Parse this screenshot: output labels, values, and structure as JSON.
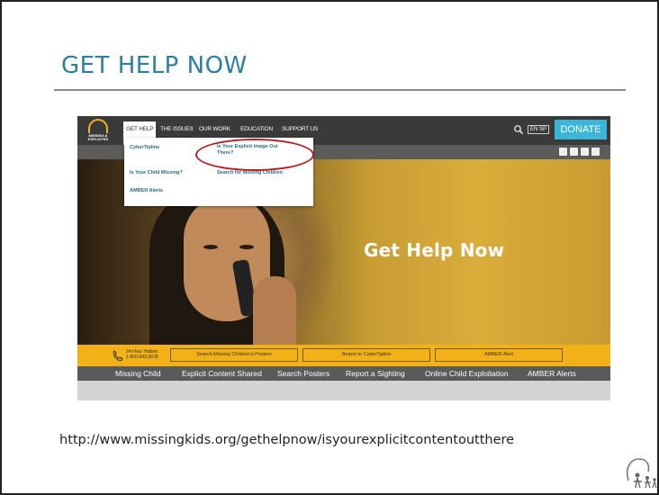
{
  "slide": {
    "title": "GET HELP NOW",
    "url": "http://www.missingkids.org/gethelpnow/isyourexplicitcontentoutthere"
  },
  "site": {
    "logo_text": "MISSING & EXPLOITED",
    "nav": [
      "GET HELP",
      "THE ISSUES",
      "OUR WORK",
      "EDUCATION",
      "SUPPORT US"
    ],
    "lang": "EN SP",
    "donate": "DONATE",
    "dropdown": {
      "cybertipline": "CyberTipline",
      "explicit": "Is Your Explicit Image Out There?",
      "child_missing": "Is Your Child Missing?",
      "search_missing": "Search for Missing Children",
      "amber": "AMBER Alerts"
    },
    "hero_text": "Get Help Now",
    "hotline": {
      "label": "24-Hour Hotline",
      "number": "1-800-843-5678"
    },
    "buttons": [
      "Search Missing Children's Posters",
      "Report to CyberTipline",
      "AMBER Alert"
    ],
    "bottom_nav": [
      "Missing Child",
      "Explicit Content Shared",
      "Search Posters",
      "Report a Sighting",
      "Online Child Exploitation",
      "AMBER Alerts"
    ]
  },
  "colors": {
    "title": "#2b7fa3",
    "donate": "#3bb5d8",
    "accent_bar": "#f2b116",
    "highlight": "#b52020"
  }
}
